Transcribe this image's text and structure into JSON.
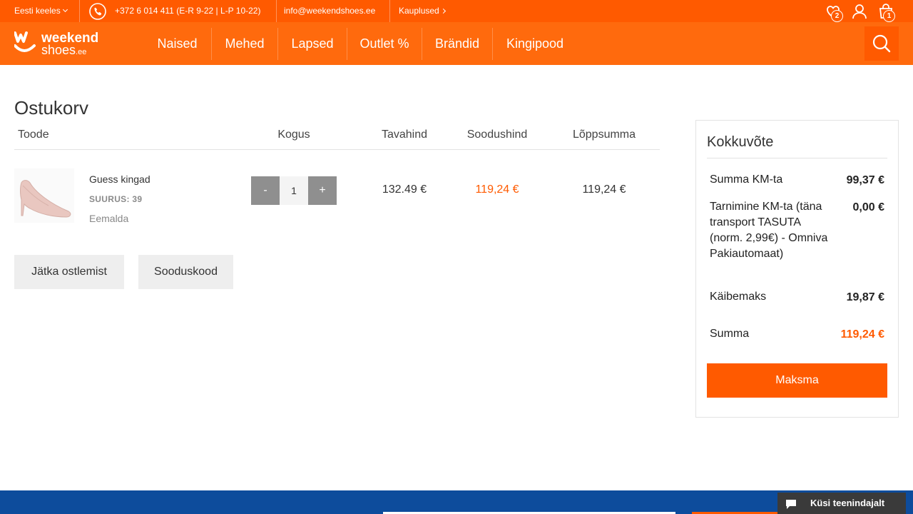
{
  "topbar": {
    "language": "Eesti keeles",
    "phone": "+372 6 014 411 (E-R 9-22 | L-P 10-22)",
    "email": "info@weekendshoes.ee",
    "stores": "Kauplused",
    "wishlist_count": "2",
    "cart_count": "1"
  },
  "nav": {
    "logo_text": "weekend shoes.ee",
    "items": [
      "Naised",
      "Mehed",
      "Lapsed",
      "Outlet %",
      "Brändid",
      "Kingipood"
    ]
  },
  "cart": {
    "title": "Ostukorv",
    "headers": {
      "product": "Toode",
      "quantity": "Kogus",
      "regular_price": "Tavahind",
      "sale_price": "Soodushind",
      "total": "Lõppsumma"
    },
    "item": {
      "name": "Guess kingad",
      "size": "SUURUS: 39",
      "remove": "Eemalda",
      "minus": "-",
      "quantity": "1",
      "plus": "+",
      "regular_price": "132.49 €",
      "sale_price": "119,24 €",
      "total": "119,24 €"
    },
    "continue_button": "Jätka ostlemist",
    "coupon_button": "Sooduskood"
  },
  "summary": {
    "title": "Kokkuvõte",
    "rows": [
      {
        "label": "Summa KM-ta",
        "value": "99,37 €"
      },
      {
        "label": "Tarnimine KM-ta (täna transport TASUTA (norm. 2,99€) - Omniva Pakiautomaat)",
        "value": "0,00 €"
      },
      {
        "label": "Käibemaks",
        "value": "19,87 €"
      },
      {
        "label": "Summa",
        "value": "119,24 €"
      }
    ],
    "pay_button": "Maksma"
  },
  "chat": {
    "label": "Küsi teenindajalt"
  },
  "colors": {
    "brand_orange": "#ff5a00",
    "footer_blue": "#0d4c9c"
  }
}
